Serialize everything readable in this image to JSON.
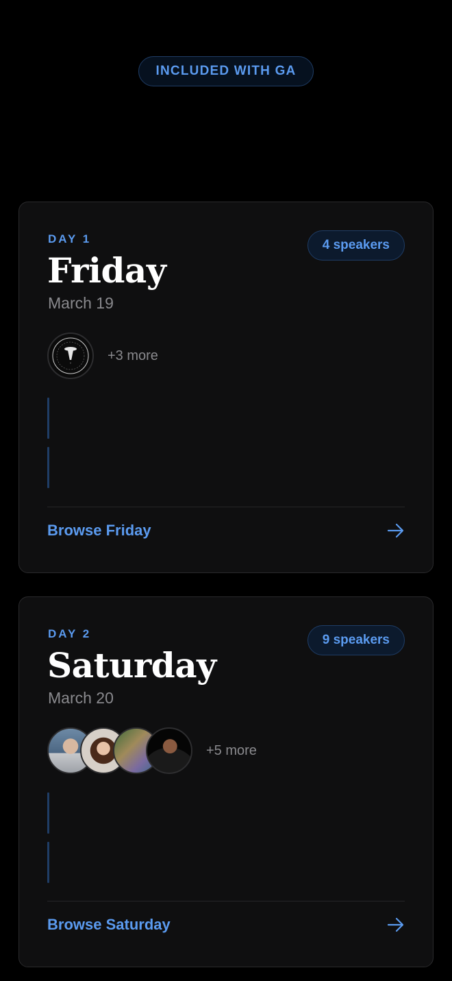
{
  "header": {
    "badge_label": "INCLUDED WITH GA"
  },
  "days": [
    {
      "day_label": "DAY 1",
      "name": "Friday",
      "date": "March 19",
      "speakers_badge": "4 speakers",
      "more_speakers": "+3 more",
      "browse_label": "Browse Friday",
      "avatars": [
        {
          "icon": "frightlife-logo-icon"
        }
      ]
    },
    {
      "day_label": "DAY 2",
      "name": "Saturday",
      "date": "March 20",
      "speakers_badge": "9 speakers",
      "more_speakers": "+5 more",
      "browse_label": "Browse Saturday",
      "avatars": [
        {
          "icon": "speaker-avatar"
        },
        {
          "icon": "speaker-avatar"
        },
        {
          "icon": "speaker-avatar"
        },
        {
          "icon": "speaker-avatar"
        }
      ]
    }
  ],
  "colors": {
    "accent": "#5b9bf0",
    "badge_border": "#1f3d66",
    "card_bg": "#0f0f10",
    "muted_text": "#8a8a8e"
  }
}
